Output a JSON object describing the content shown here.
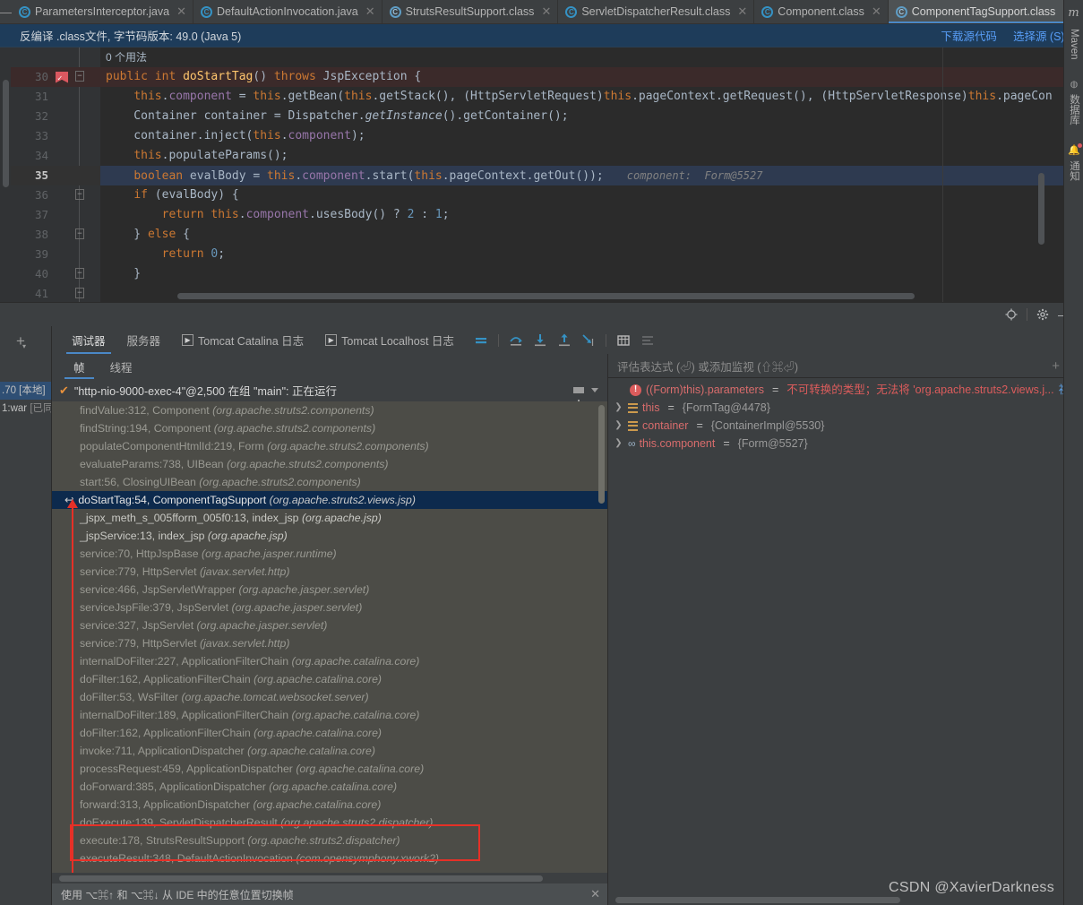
{
  "tabs": [
    {
      "label": "ParametersInterceptor.java",
      "icon": "java-class-icon",
      "active": false
    },
    {
      "label": "DefaultActionInvocation.java",
      "icon": "java-class-icon",
      "active": false
    },
    {
      "label": "StrutsResultSupport.class",
      "icon": "compiled-class-icon",
      "active": false
    },
    {
      "label": "ServletDispatcherResult.class",
      "icon": "java-class-icon",
      "active": false
    },
    {
      "label": "Component.class",
      "icon": "java-class-icon",
      "active": false
    },
    {
      "label": "ComponentTagSupport.class",
      "icon": "compiled-class-icon",
      "active": true
    }
  ],
  "tab_actions": {
    "dropdown": "chevron-down-icon",
    "more": "more-vertical-icon"
  },
  "notification": {
    "message": "反编译 .class文件, 字节码版本: 49.0 (Java 5)",
    "link_download": "下载源代码",
    "link_choose": "选择源 (S)..."
  },
  "editor": {
    "usage_hint": "0 个用法",
    "lines": [
      {
        "num": "30",
        "breakpoint": true,
        "fold": "minus",
        "html": "<span class=\"kw\">public</span> <span class=\"kw\">int</span> <span class=\"mth\">doStartTag</span>() <span class=\"kw\">throws</span> JspException {"
      },
      {
        "num": "31",
        "html": "    <span class=\"kw\">this</span>.<span class=\"fld\">component</span> = <span class=\"kw\">this</span>.getBean(<span class=\"kw\">this</span>.getStack(), (HttpServletRequest)<span class=\"kw\">this</span>.pageContext.getRequest(), (HttpServletResponse)<span class=\"kw\">this</span>.pageCon"
      },
      {
        "num": "32",
        "html": "    Container container = Dispatcher.<span class=\"italic\">getInstance</span>().getContainer();"
      },
      {
        "num": "33",
        "html": "    container.inject(<span class=\"kw\">this</span>.<span class=\"fld\">component</span>);"
      },
      {
        "num": "34",
        "html": "    <span class=\"kw\">this</span>.populateParams();"
      },
      {
        "num": "35",
        "current": true,
        "html": "    <span class=\"kw\">boolean</span> evalBody = <span class=\"kw\">this</span>.<span class=\"fld\">component</span>.start(<span class=\"kw\">this</span>.pageContext.getOut());",
        "inline_hint": "component:  Form@5527"
      },
      {
        "num": "36",
        "fold": "minus",
        "html": "    <span class=\"kw\">if</span> (evalBody) {"
      },
      {
        "num": "37",
        "html": "        <span class=\"kw\">return</span> <span class=\"kw\">this</span>.<span class=\"fld\">component</span>.usesBody() ? <span class=\"num2\">2</span> : <span class=\"num2\">1</span>;"
      },
      {
        "num": "38",
        "fold": "minus2",
        "html": "    } <span class=\"kw\">else</span> {"
      },
      {
        "num": "39",
        "html": "        <span class=\"kw\">return</span> <span class=\"num2\">0</span>;"
      },
      {
        "num": "40",
        "fold": "minus2",
        "html": "    }"
      },
      {
        "num": "41",
        "fold": "minus2",
        "html": ""
      }
    ]
  },
  "toolwindow_icons": {
    "settings_target": "crosshair-icon",
    "settings": "gear-icon",
    "minimize": "minimize-icon",
    "layout": "layout-icon"
  },
  "debug": {
    "rail": {
      "add": "add-configuration-icon",
      "runs": [
        {
          "label": ".70 [本地]",
          "selected": true
        },
        {
          "label": "1:war",
          "suffix": "[已同",
          "selected": false
        }
      ]
    },
    "tabs": [
      {
        "label": "调试器",
        "active": true
      },
      {
        "label": "服务器",
        "active": false
      },
      {
        "label": "Tomcat Catalina 日志",
        "icon": "run-icon",
        "active": false
      },
      {
        "label": "Tomcat Localhost 日志",
        "icon": "run-icon",
        "active": false
      }
    ],
    "toolbar_icons": [
      "mute-breakpoints-icon",
      "step-over-icon",
      "step-into-icon",
      "step-out-icon",
      "run-to-cursor-icon",
      "evaluate-table-icon",
      "settings-lines-icon"
    ],
    "frames_tabs": [
      {
        "label": "帧",
        "active": true
      },
      {
        "label": "线程",
        "active": false
      }
    ],
    "thread": {
      "label": "\"http-nio-9000-exec-4\"@2,500 在组 \"main\": 正在运行",
      "check_icon": "checkmark-icon",
      "filter_icon": "filter-funnel-icon",
      "dropdown_icon": "chevron-down-icon"
    },
    "frames": [
      {
        "method": "findValue:312, Component",
        "package": "(org.apache.struts2.components)"
      },
      {
        "method": "findString:194, Component",
        "package": "(org.apache.struts2.components)"
      },
      {
        "method": "populateComponentHtmlId:219, Form",
        "package": "(org.apache.struts2.components)"
      },
      {
        "method": "evaluateParams:738, UIBean",
        "package": "(org.apache.struts2.components)"
      },
      {
        "method": "start:56, ClosingUIBean",
        "package": "(org.apache.struts2.components)"
      },
      {
        "method": "doStartTag:54, ComponentTagSupport",
        "package": "(org.apache.struts2.views.jsp)",
        "selected": true
      },
      {
        "method": "_jspx_meth_s_005fform_005f0:13, index_jsp",
        "package": "(org.apache.jsp)",
        "bright": true
      },
      {
        "method": "_jspService:13, index_jsp",
        "package": "(org.apache.jsp)",
        "bright": true
      },
      {
        "method": "service:70, HttpJspBase",
        "package": "(org.apache.jasper.runtime)"
      },
      {
        "method": "service:779, HttpServlet",
        "package": "(javax.servlet.http)"
      },
      {
        "method": "service:466, JspServletWrapper",
        "package": "(org.apache.jasper.servlet)"
      },
      {
        "method": "serviceJspFile:379, JspServlet",
        "package": "(org.apache.jasper.servlet)"
      },
      {
        "method": "service:327, JspServlet",
        "package": "(org.apache.jasper.servlet)"
      },
      {
        "method": "service:779, HttpServlet",
        "package": "(javax.servlet.http)"
      },
      {
        "method": "internalDoFilter:227, ApplicationFilterChain",
        "package": "(org.apache.catalina.core)"
      },
      {
        "method": "doFilter:162, ApplicationFilterChain",
        "package": "(org.apache.catalina.core)"
      },
      {
        "method": "doFilter:53, WsFilter",
        "package": "(org.apache.tomcat.websocket.server)"
      },
      {
        "method": "internalDoFilter:189, ApplicationFilterChain",
        "package": "(org.apache.catalina.core)"
      },
      {
        "method": "doFilter:162, ApplicationFilterChain",
        "package": "(org.apache.catalina.core)"
      },
      {
        "method": "invoke:711, ApplicationDispatcher",
        "package": "(org.apache.catalina.core)"
      },
      {
        "method": "processRequest:459, ApplicationDispatcher",
        "package": "(org.apache.catalina.core)"
      },
      {
        "method": "doForward:385, ApplicationDispatcher",
        "package": "(org.apache.catalina.core)"
      },
      {
        "method": "forward:313, ApplicationDispatcher",
        "package": "(org.apache.catalina.core)"
      },
      {
        "method": "doExecute:139, ServletDispatcherResult",
        "package": "(org.apache.struts2.dispatcher)"
      },
      {
        "method": "execute:178, StrutsResultSupport",
        "package": "(org.apache.struts2.dispatcher)"
      },
      {
        "method": "executeResult:348, DefaultActionInvocation",
        "package": "(com.opensymphony.xwork2)"
      }
    ],
    "hint_bar": {
      "text": "使用 ⌥⌘↑ 和 ⌥⌘↓ 从 IDE 中的任意位置切换帧",
      "close_icon": "close-icon"
    },
    "watch": {
      "placeholder": "评估表达式 (⏎) 或添加监视 (⇧⌘⏎)",
      "add_icon": "add-watch-icon",
      "dropdown_icon": "chevron-down-icon"
    },
    "variables": [
      {
        "icon": "error-icon",
        "name": "((Form)this).parameters",
        "eq": "=",
        "error": "不可转换的类型；无法将 'org.apache.struts2.views.j...",
        "link": "视图",
        "expandable": false
      },
      {
        "icon": "object-icon",
        "name": "this",
        "eq": "=",
        "value": "{FormTag@4478}",
        "expandable": true
      },
      {
        "icon": "object-icon",
        "name": "container",
        "eq": "=",
        "value": "{ContainerImpl@5530}",
        "expandable": true
      },
      {
        "icon": "field-link-icon",
        "name": "this.component",
        "eq": "=",
        "value": "{Form@5527}",
        "expandable": true
      }
    ]
  },
  "right_rail": {
    "logo": "m",
    "items": [
      {
        "label": "Maven",
        "icon": ""
      },
      {
        "label": "数据库",
        "icon": "database-icon"
      },
      {
        "label": "通知",
        "icon": "bell-icon",
        "badge": true
      }
    ]
  },
  "watermark": "CSDN @XavierDarkness",
  "colors": {
    "accent": "#4a88c7",
    "error": "#db5c5c",
    "link": "#589df6",
    "highlight_line": "#2e3a50",
    "breakpoint": "#db5860",
    "red_annotation": "#e63027"
  }
}
